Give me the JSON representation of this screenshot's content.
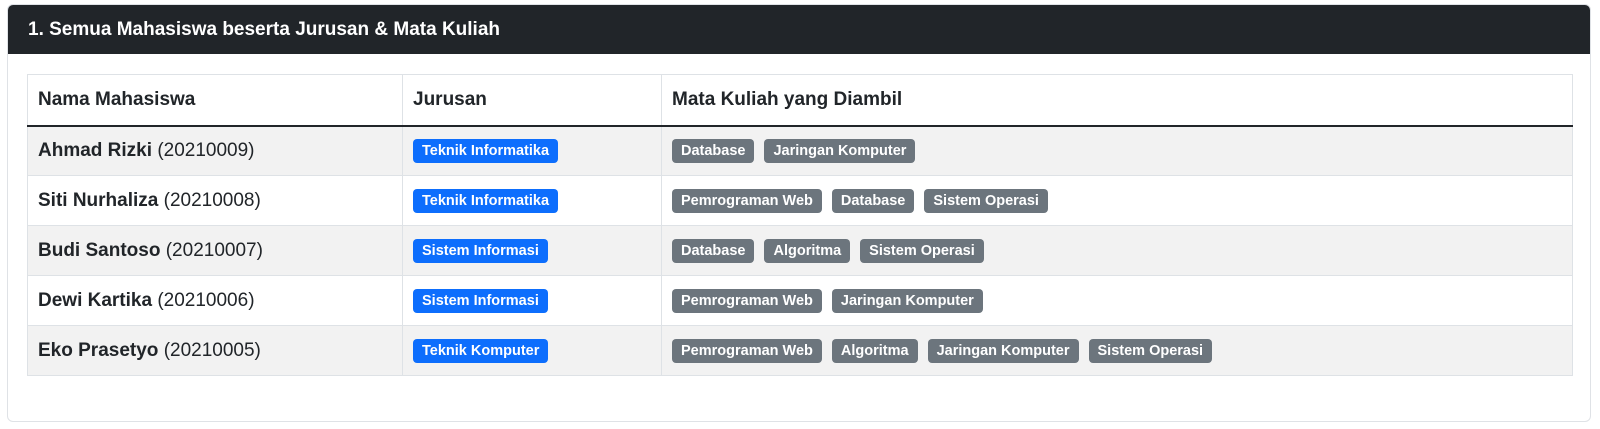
{
  "card": {
    "title": "1. Semua Mahasiswa beserta Jurusan & Mata Kuliah"
  },
  "table": {
    "headers": [
      "Nama Mahasiswa",
      "Jurusan",
      "Mata Kuliah yang Diambil"
    ],
    "rows": [
      {
        "name": "Ahmad Rizki",
        "nim": "(20210009)",
        "jurusan": "Teknik Informatika",
        "courses": [
          "Database",
          "Jaringan Komputer"
        ]
      },
      {
        "name": "Siti Nurhaliza",
        "nim": "(20210008)",
        "jurusan": "Teknik Informatika",
        "courses": [
          "Pemrograman Web",
          "Database",
          "Sistem Operasi"
        ]
      },
      {
        "name": "Budi Santoso",
        "nim": "(20210007)",
        "jurusan": "Sistem Informasi",
        "courses": [
          "Database",
          "Algoritma",
          "Sistem Operasi"
        ]
      },
      {
        "name": "Dewi Kartika",
        "nim": "(20210006)",
        "jurusan": "Sistem Informasi",
        "courses": [
          "Pemrograman Web",
          "Jaringan Komputer"
        ]
      },
      {
        "name": "Eko Prasetyo",
        "nim": "(20210005)",
        "jurusan": "Teknik Komputer",
        "courses": [
          "Pemrograman Web",
          "Algoritma",
          "Jaringan Komputer",
          "Sistem Operasi"
        ]
      }
    ]
  },
  "colors": {
    "header_bg": "#212529",
    "jurusan_badge": "#0d6efd",
    "course_badge": "#6c757d",
    "striped_row": "#f2f2f2"
  }
}
